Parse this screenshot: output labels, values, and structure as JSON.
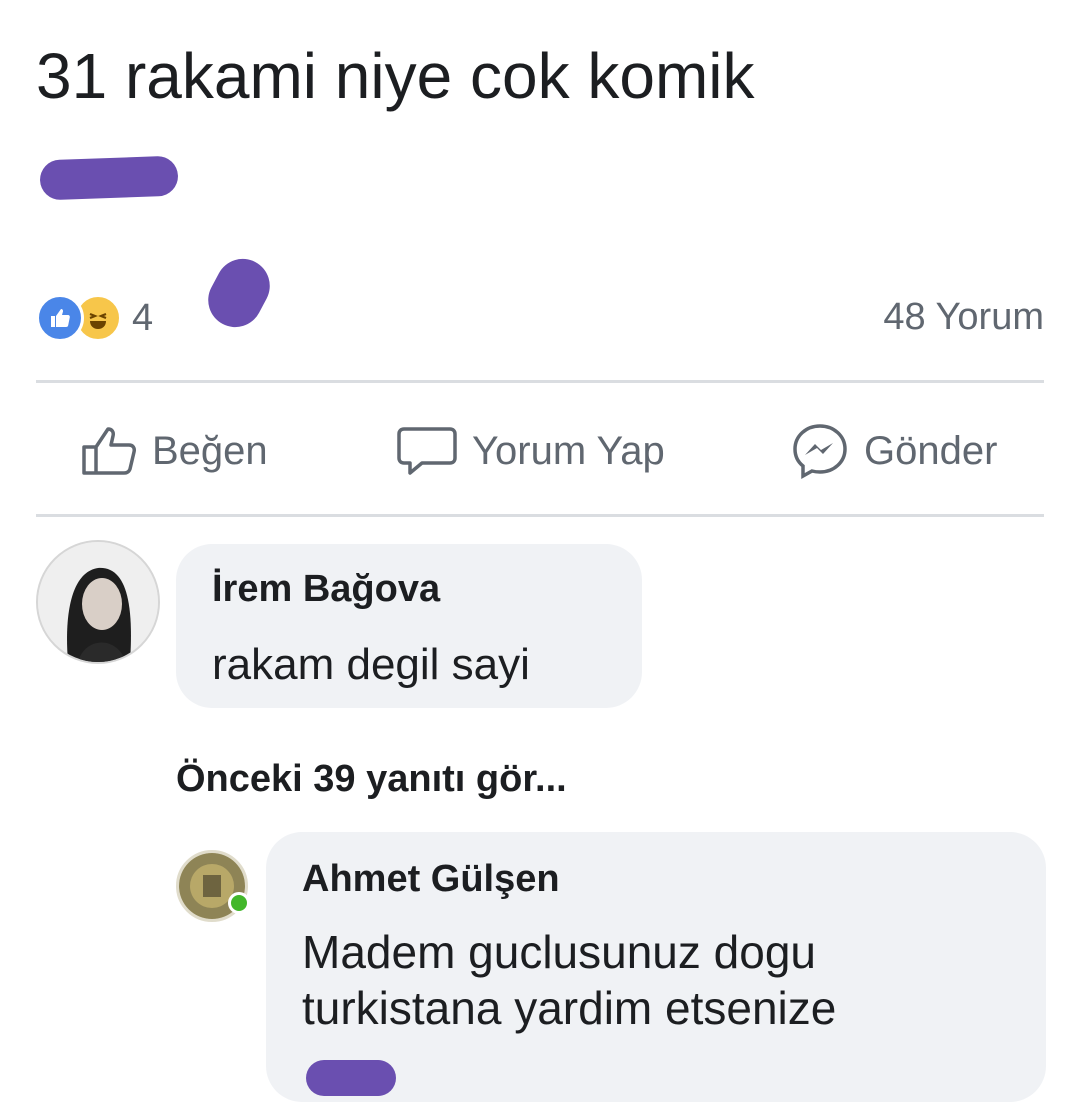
{
  "post": {
    "text": "31 rakami niye cok komik",
    "reaction_count": "4",
    "comment_count": "48 Yorum"
  },
  "actions": {
    "like_label": "Beğen",
    "comment_label": "Yorum Yap",
    "send_label": "Gönder"
  },
  "comments": [
    {
      "author": "İrem Bağova",
      "text": "rakam degil sayi"
    }
  ],
  "previous_replies_label": "Önceki 39 yanıtı gör...",
  "replies": [
    {
      "author": "Ahmet Gülşen",
      "text": "Madem guclusunuz dogu turkistana yardim etsenize"
    }
  ],
  "colors": {
    "redaction": "#6a4fb0",
    "like_blue": "#4a86e8",
    "haha_yellow": "#f7c64a",
    "bubble_bg": "#f0f2f5",
    "secondary_text": "#606770"
  }
}
